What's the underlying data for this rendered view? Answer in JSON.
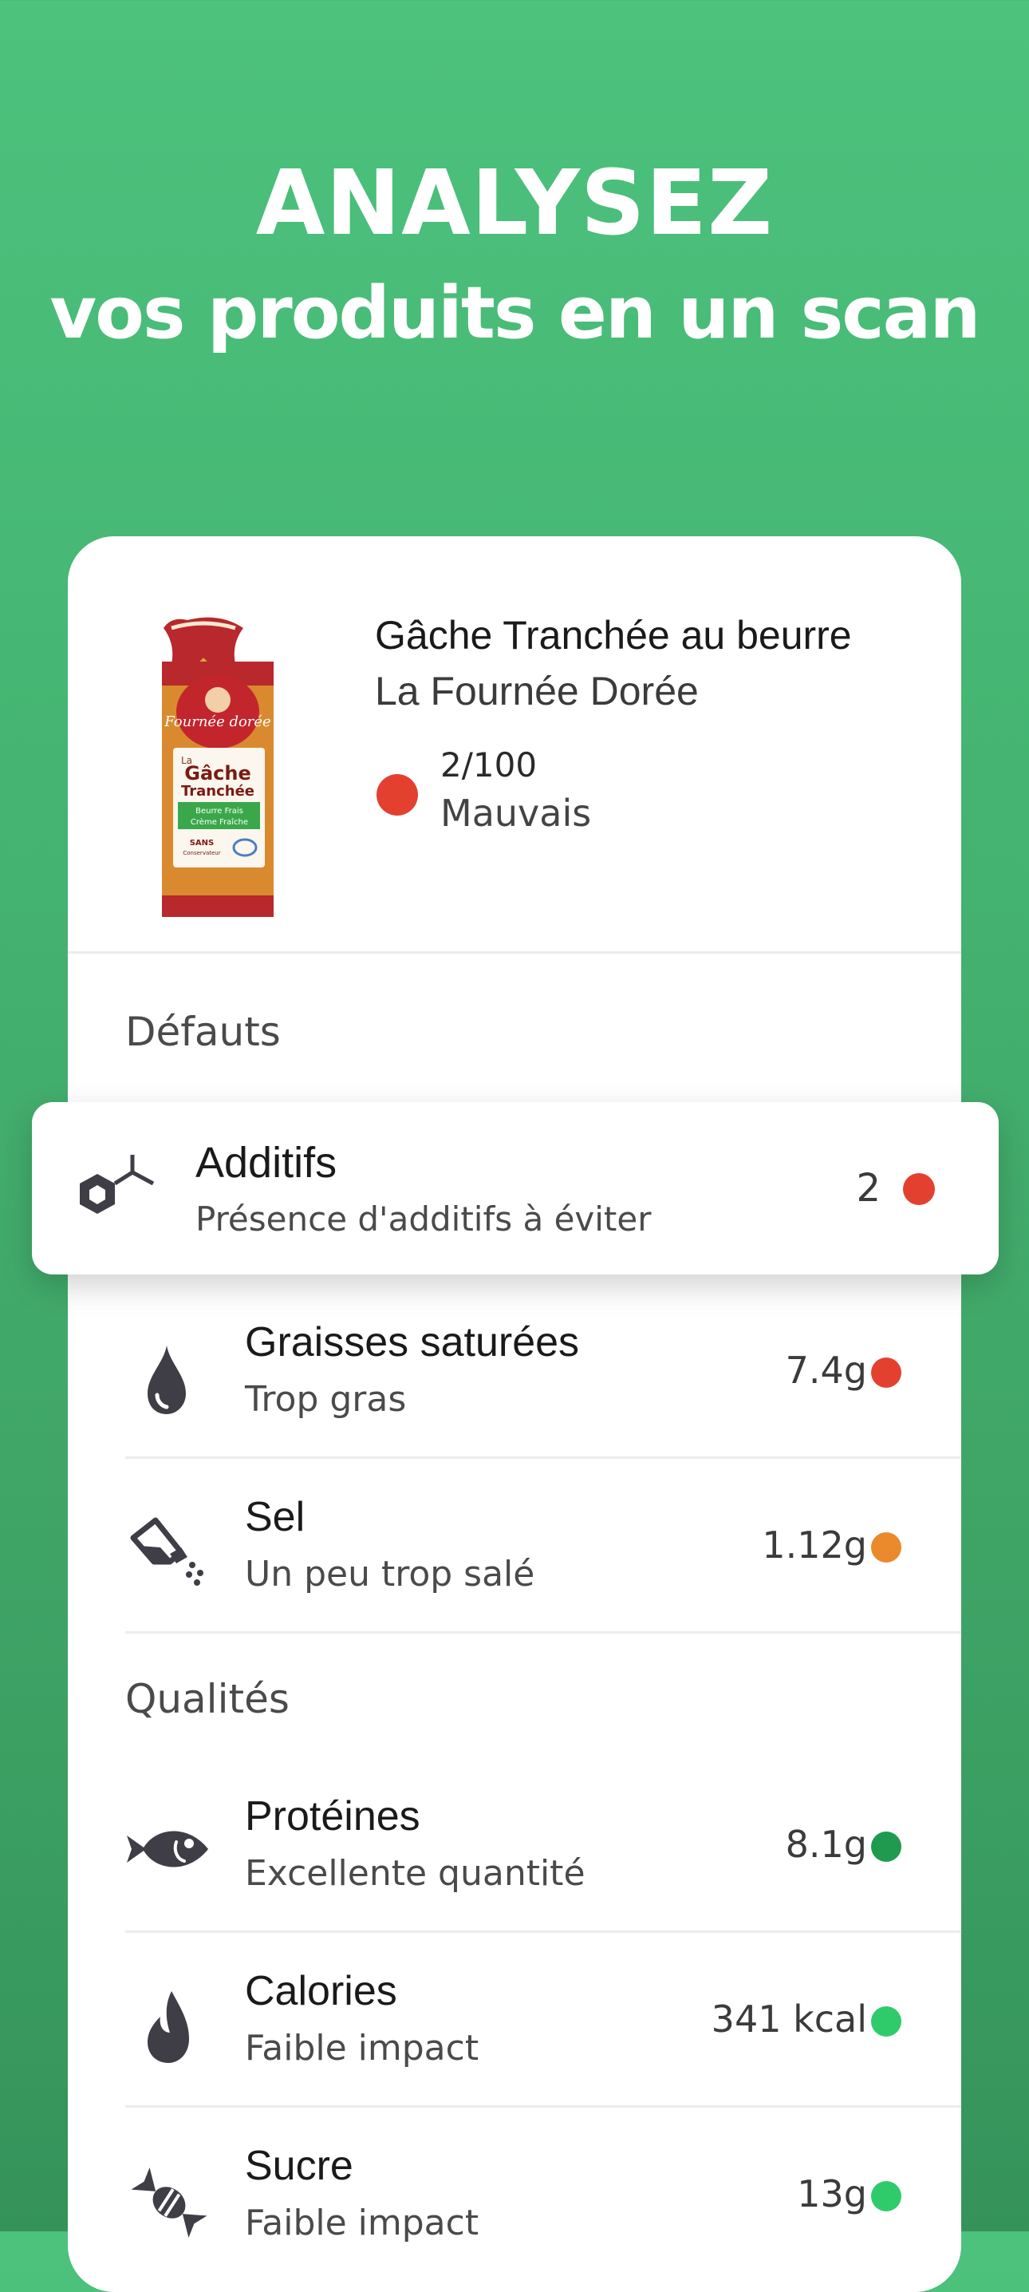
{
  "header": {
    "line1": "ANALYSEZ",
    "line2": "vos produits en un scan"
  },
  "product": {
    "name": "Gâche Tranchée au beurre",
    "brand": "La Fournée Dorée",
    "score": "2/100",
    "score_label": "Mauvais",
    "score_color": "#e4402f",
    "package_text": {
      "brand_logo": "Fournée dorée",
      "line1": "La",
      "line2": "Gâche",
      "line3": "Tranchée",
      "banner1": "Beurre Frais",
      "banner2": "Crème Fraîche",
      "badge1": "SANS",
      "badge2": "Conservateur"
    }
  },
  "defects": {
    "title": "Défauts",
    "items": [
      {
        "title": "Additifs",
        "subtitle": "Présence d'additifs à éviter",
        "value": "2",
        "color": "#e4402f",
        "icon": "molecule-icon"
      },
      {
        "title": "Graisses saturées",
        "subtitle": "Trop gras",
        "value": "7.4g",
        "color": "#e4402f",
        "icon": "drop-icon"
      },
      {
        "title": "Sel",
        "subtitle": "Un peu trop salé",
        "value": "1.12g",
        "color": "#ea8a2c",
        "icon": "salt-shaker-icon"
      }
    ]
  },
  "qualities": {
    "title": "Qualités",
    "items": [
      {
        "title": "Protéines",
        "subtitle": "Excellente quantité",
        "value": "8.1g",
        "color": "#1f9a4e",
        "icon": "fish-icon"
      },
      {
        "title": "Calories",
        "subtitle": "Faible impact",
        "value": "341 kcal",
        "color": "#2fcb6b",
        "icon": "flame-icon"
      },
      {
        "title": "Sucre",
        "subtitle": "Faible impact",
        "value": "13g",
        "color": "#2fcb6b",
        "icon": "candy-icon"
      }
    ]
  }
}
